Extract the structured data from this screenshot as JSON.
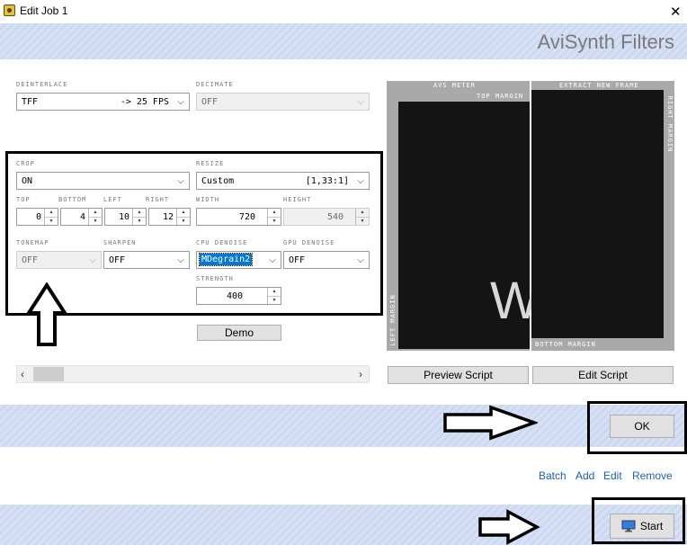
{
  "window": {
    "title": "Edit Job 1",
    "header": "AviSynth Filters"
  },
  "fields": {
    "deinterlace": {
      "label": "DEINTERLACE",
      "value": "TFF",
      "extra": "-> 25 FPS"
    },
    "decimate": {
      "label": "DECIMATE",
      "value": "OFF"
    },
    "crop": {
      "label": "CROP",
      "value": "ON"
    },
    "resize": {
      "label": "RESIZE",
      "value": "Custom",
      "extra": "[1,33:1]"
    },
    "top": {
      "label": "TOP",
      "value": "0"
    },
    "bottom": {
      "label": "BOTTOM",
      "value": "4"
    },
    "left": {
      "label": "LEFT",
      "value": "10"
    },
    "right": {
      "label": "RIGHT",
      "value": "12"
    },
    "width": {
      "label": "WIDTH",
      "value": "720"
    },
    "height": {
      "label": "HEIGHT",
      "value": "540"
    },
    "tonemap": {
      "label": "TONEMAP",
      "value": "OFF"
    },
    "sharpen": {
      "label": "SHARPEN",
      "value": "OFF"
    },
    "cpu_denoise": {
      "label": "CPU DENOISE",
      "value": "MDegrain2"
    },
    "gpu_denoise": {
      "label": "GPU DENOISE",
      "value": "OFF"
    },
    "strength": {
      "label": "STRENGTH",
      "value": "400"
    }
  },
  "buttons": {
    "demo": "Demo",
    "preview_script": "Preview Script",
    "edit_script": "Edit Script",
    "ok": "OK",
    "start": "Start"
  },
  "preview": {
    "avs_meter": "AVS METER",
    "extract_new_frame": "EXTRACT NEW FRAME",
    "top_margin": "TOP MARGIN",
    "right_margin": "RIGHT MARGIN",
    "left_margin": "LEFT MARGIN",
    "bottom_margin": "BOTTOM MARGIN",
    "frame_letter": "W"
  },
  "links": {
    "batch": "Batch",
    "add": "Add",
    "edit": "Edit",
    "remove": "Remove"
  },
  "colors": {
    "link": "#1a5fb4",
    "selection": "#0078d7",
    "band": "#d6e0f4"
  }
}
